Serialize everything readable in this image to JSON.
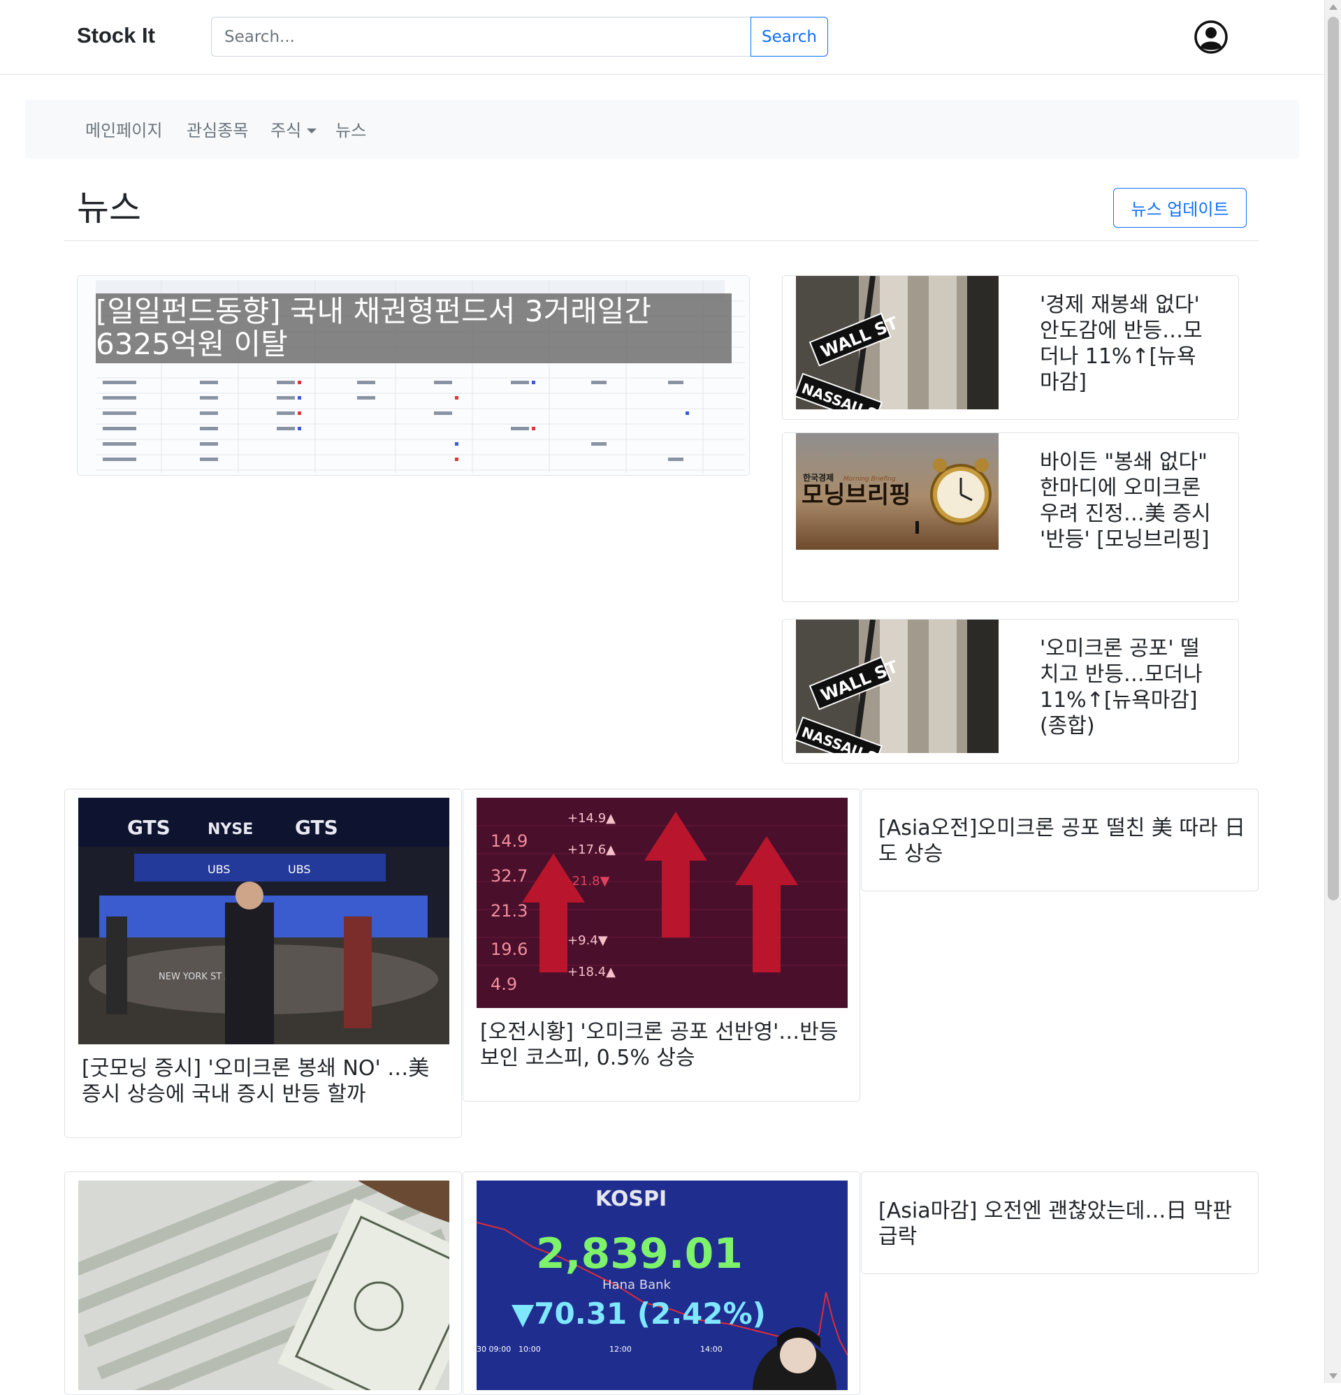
{
  "header": {
    "brand": "Stock It",
    "search_placeholder": "Search...",
    "search_button": "Search"
  },
  "nav": {
    "items": [
      {
        "label": "메인페이지"
      },
      {
        "label": "관심종목"
      },
      {
        "label": "주식"
      },
      {
        "label": "뉴스"
      }
    ]
  },
  "page": {
    "title": "뉴스",
    "update_button": "뉴스 업데이트"
  },
  "featured": {
    "title": "[일일펀드동향] 국내 채권형펀드서 3거래일간 6325억원 이탈"
  },
  "side_articles": [
    {
      "title": "'경제 재봉쇄 없다' 안도감에 반등…모더나 11%↑[뉴욕마감]"
    },
    {
      "title": "바이든 \"봉쇄 없다\" 한마디에 오미크론 우려 진정…美 증시 '반등' [모닝브리핑]"
    },
    {
      "title": "'오미크론 공포' 떨치고 반등…모더나 11%↑[뉴욕마감](종합)"
    }
  ],
  "grid_row1": [
    {
      "title": "[굿모닝 증시] '오미크론 봉쇄 NO' …美 증시 상승에 국내 증시 반등 할까"
    },
    {
      "title": "[오전시황] '오미크론 공포 선반영'…반등 보인 코스피, 0.5% 상승"
    },
    {
      "title": "[Asia오전]오미크론 공포 떨친 美 따라 日도 상승"
    }
  ],
  "grid_row2": [
    {
      "title": ""
    },
    {
      "title": ""
    },
    {
      "title": "[Asia마감] 오전엔 괜찮았는데…日 막판 급락"
    }
  ],
  "image_text": {
    "wall_st": "WALL ST",
    "nassau": "NASSAU ST",
    "morning_brand": "한국경제",
    "morning_sub": "Morning Briefing",
    "morning_title": "모닝브리핑",
    "gts": "GTS",
    "nyse": "NYSE",
    "ubs": "UBS",
    "nyse_banner": "NEW YORK ST    ANGE",
    "market_numbers": [
      "14.9",
      "32.7",
      "21.3",
      "19.6",
      "4.9",
      "+14.9▲",
      "+17.6▲",
      "-21.8▼",
      "+9.4▼",
      "+18.4▲"
    ],
    "kospi_label": "KOSPI",
    "kospi_value": "2,839.01",
    "kospi_change": "▼70.31  (2.42%)",
    "kospi_bank": "Hana Bank",
    "kospi_times": [
      "30 09:00",
      "10:00",
      "12:00",
      "14:00"
    ]
  },
  "colors": {
    "primary": "#0d6efd",
    "nav_bg": "#f8f9fa",
    "muted": "#6c757d",
    "caption_bg": "#6e6e6e"
  }
}
